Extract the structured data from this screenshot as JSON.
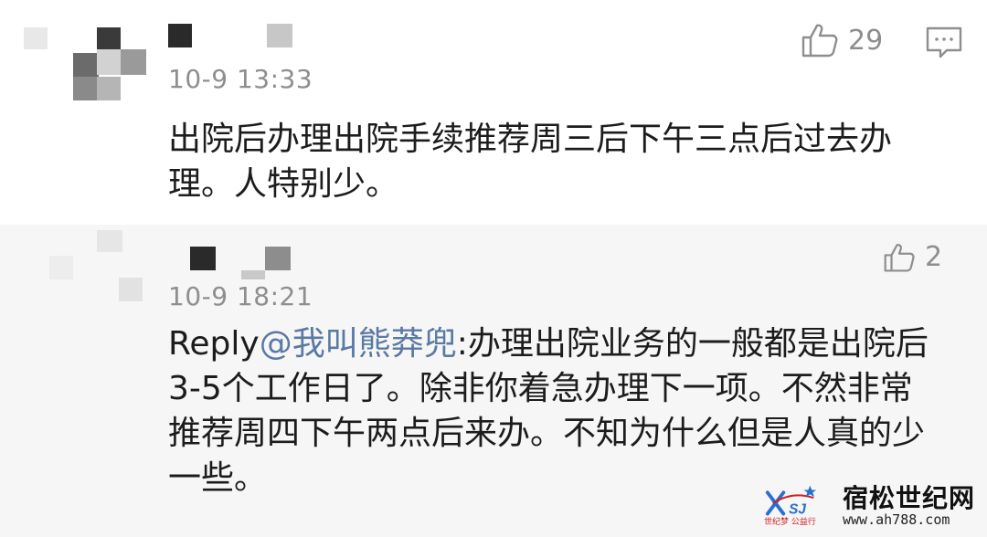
{
  "comments": [
    {
      "time": "10-9 13:33",
      "likes": "29",
      "content_lines": [
        "出院后办理出院手续推荐周三后下午三点后过去办",
        "理。人特别少。"
      ],
      "icons": {
        "like": "thumbs-up-icon",
        "reply": "comment-icon",
        "avatar": "pixelated-avatar-icon"
      }
    },
    {
      "time": "10-9 18:21",
      "likes": "2",
      "reply_prefix": "Reply",
      "mention": "@我叫熊莽兜",
      "content_after_mention": ":办理出院业务的一般都是出院后",
      "content_lines": [
        "3-5个工作日了。除非你着急办理下一项。不然非常",
        "推荐周四下午两点后来办。不知为什么但是人真的少",
        "一些。"
      ],
      "icons": {
        "like": "thumbs-up-icon",
        "avatar": "pixelated-avatar-icon"
      }
    }
  ],
  "watermark": {
    "site_name": "宿松世纪网",
    "url": "www.ah788.com",
    "tagline": "世纪梦 公益行",
    "colors": {
      "logo_blue": "#2a6fd0",
      "logo_red": "#d02020"
    }
  },
  "colors": {
    "time": "#8e8e8e",
    "mention": "#5a79a4",
    "reply_bg": "#f6f6f6"
  }
}
